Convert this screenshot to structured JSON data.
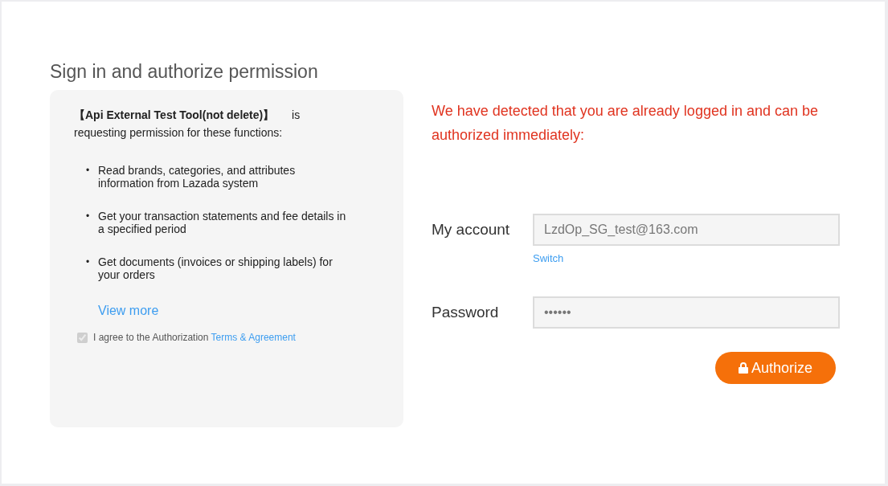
{
  "page": {
    "title": "Sign in and authorize permission"
  },
  "permissions": {
    "intro": "**【Api External Test Tool(not delete)】** is requesting permission for these functions:",
    "items": [
      {
        "bullet": "•",
        "text": "Read brands, categories, and attributes information from Lazada system"
      },
      {
        "bullet": "•",
        "text": "Get your transaction statements and fee details in a specified period"
      },
      {
        "bullet": "•",
        "text": "Get documents (invoices or shipping labels) for your orders"
      }
    ],
    "view_more": "View more",
    "agreement": {
      "checked": true,
      "disabled": true,
      "text": "I agree to the Authorization",
      "link": "Terms & Agreement"
    }
  },
  "login": {
    "notice": "We have detected that you are already logged in and can be authorized immediately:",
    "fields": [
      {
        "label": "My account",
        "value": "LzdOp_SG_test@163.com",
        "link": "Switch"
      },
      {
        "label": "Password",
        "value": "••••••"
      }
    ],
    "submit": "Authorize"
  }
}
